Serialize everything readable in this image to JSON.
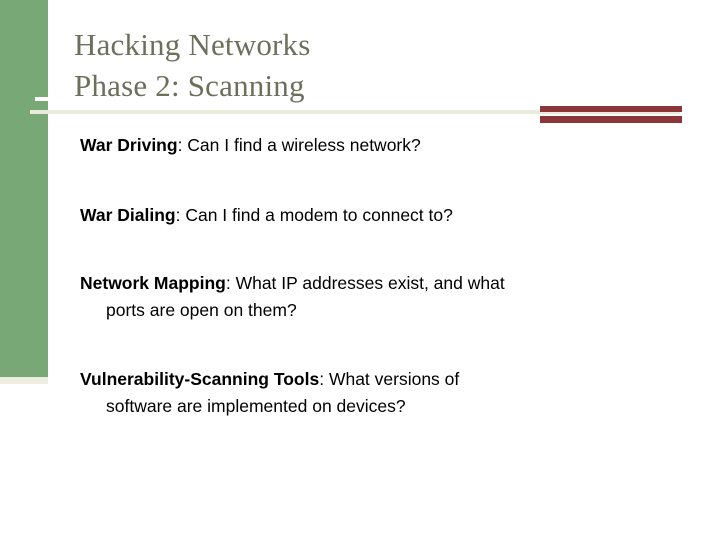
{
  "slide": {
    "title_lines": [
      "Hacking Networks",
      "Phase 2: Scanning"
    ],
    "bullets": [
      {
        "term": "War Driving",
        "separator": ": ",
        "text": "Can I find a wireless network?",
        "continuation": ""
      },
      {
        "term": "War Dialing",
        "separator": ": ",
        "text": "Can I find a modem to connect to?",
        "continuation": ""
      },
      {
        "term": "Network Mapping",
        "separator": ": ",
        "text": "What IP addresses exist, and what",
        "continuation": "ports are open on them?"
      },
      {
        "term": "Vulnerability-Scanning Tools",
        "separator": ": ",
        "text": "What versions of",
        "continuation": "software are implemented on devices?"
      }
    ],
    "colors": {
      "accent_green": "#79a877",
      "accent_red": "#8d3639",
      "divider_cream": "#e9ebdd",
      "title_text": "#6b6f5c",
      "body_text": "#000000",
      "background": "#ffffff"
    }
  }
}
